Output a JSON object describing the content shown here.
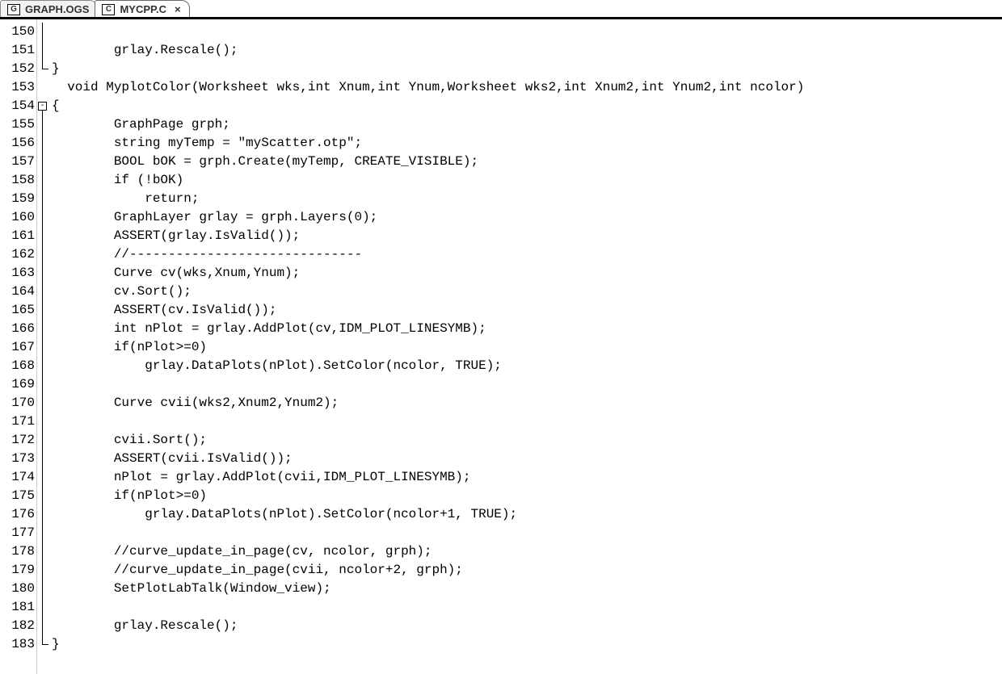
{
  "tabs": [
    {
      "label": "GRAPH.OGS",
      "icon": "G",
      "active": false
    },
    {
      "label": "MYCPP.C",
      "icon": "C",
      "active": true
    }
  ],
  "line_start": 150,
  "line_end": 183,
  "fold_marker_line": 154,
  "fold_marker_symbol": "-",
  "code_lines": [
    "",
    "        grlay.Rescale();",
    "}",
    "  void MyplotColor(Worksheet wks,int Xnum,int Ynum,Worksheet wks2,int Xnum2,int Ynum2,int ncolor)",
    "{",
    "        GraphPage grph;",
    "        string myTemp = \"myScatter.otp\";",
    "        BOOL bOK = grph.Create(myTemp, CREATE_VISIBLE);",
    "        if (!bOK)",
    "            return;",
    "        GraphLayer grlay = grph.Layers(0);",
    "        ASSERT(grlay.IsValid());",
    "        //------------------------------",
    "        Curve cv(wks,Xnum,Ynum);",
    "        cv.Sort();",
    "        ASSERT(cv.IsValid());",
    "        int nPlot = grlay.AddPlot(cv,IDM_PLOT_LINESYMB);",
    "        if(nPlot>=0)",
    "            grlay.DataPlots(nPlot).SetColor(ncolor, TRUE);",
    "",
    "        Curve cvii(wks2,Xnum2,Ynum2);",
    "",
    "        cvii.Sort();",
    "        ASSERT(cvii.IsValid());",
    "        nPlot = grlay.AddPlot(cvii,IDM_PLOT_LINESYMB);",
    "        if(nPlot>=0)",
    "            grlay.DataPlots(nPlot).SetColor(ncolor+1, TRUE);",
    "",
    "        //curve_update_in_page(cv, ncolor, grph);",
    "        //curve_update_in_page(cvii, ncolor+2, grph);",
    "        SetPlotLabTalk(Window_view);",
    "",
    "        grlay.Rescale();",
    "}"
  ]
}
